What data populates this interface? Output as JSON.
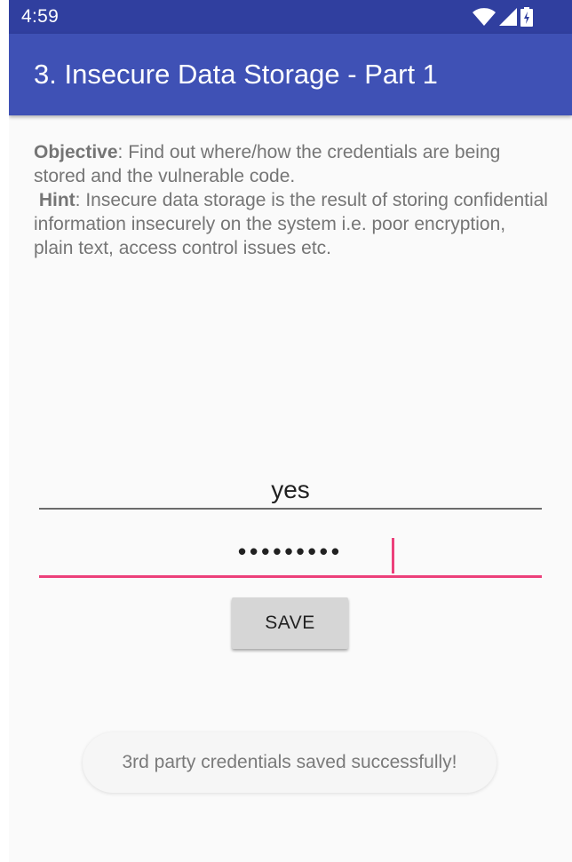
{
  "status_bar": {
    "time": "4:59",
    "icons": [
      "wifi-icon",
      "signal-icon",
      "battery-icon"
    ]
  },
  "app_bar": {
    "title": "3. Insecure Data Storage - Part 1",
    "color": "#3f51b5",
    "status_color": "#303f9f"
  },
  "content": {
    "objective_label": "Objective",
    "objective_text": ": Find out where/how the credentials are being stored and the vulnerable code.",
    "hint_label": "Hint",
    "hint_text": ": Insecure data storage is the result of storing confidential information insecurely on the system i.e. poor encryption, plain text, access control issues etc."
  },
  "form": {
    "username_value": "yes",
    "password_masked": "•••••••••",
    "save_label": "SAVE",
    "accent_color": "#ec407a"
  },
  "toast": {
    "message": "3rd party credentials saved successfully!"
  }
}
